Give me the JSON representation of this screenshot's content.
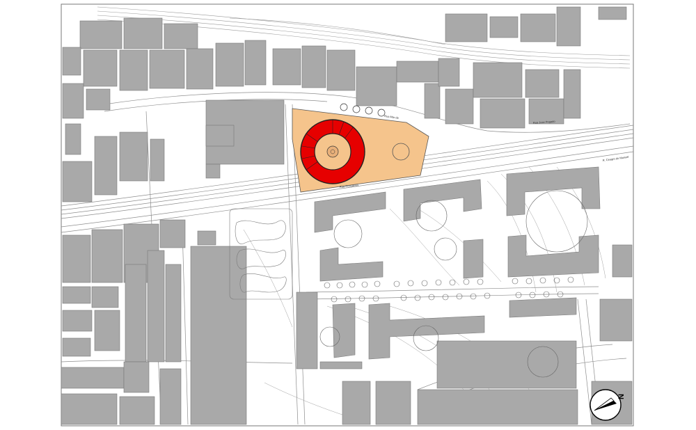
{
  "colors": {
    "building": "#a9a9a9",
    "building_stroke": "#7a7a7a",
    "line": "#8c8c8c",
    "plaza": "#f5c48c",
    "ring": "#e60000",
    "ring_stroke": "#222222",
    "center": "#f5c48c"
  },
  "streets": {
    "north": "Rua Mar de",
    "south": "Rua Jose Pegado",
    "central": "Rua Gonçalves",
    "east": "R. Ceagm do Manuel"
  },
  "compass": {
    "label": "N",
    "icon": "north-arrow-icon"
  }
}
